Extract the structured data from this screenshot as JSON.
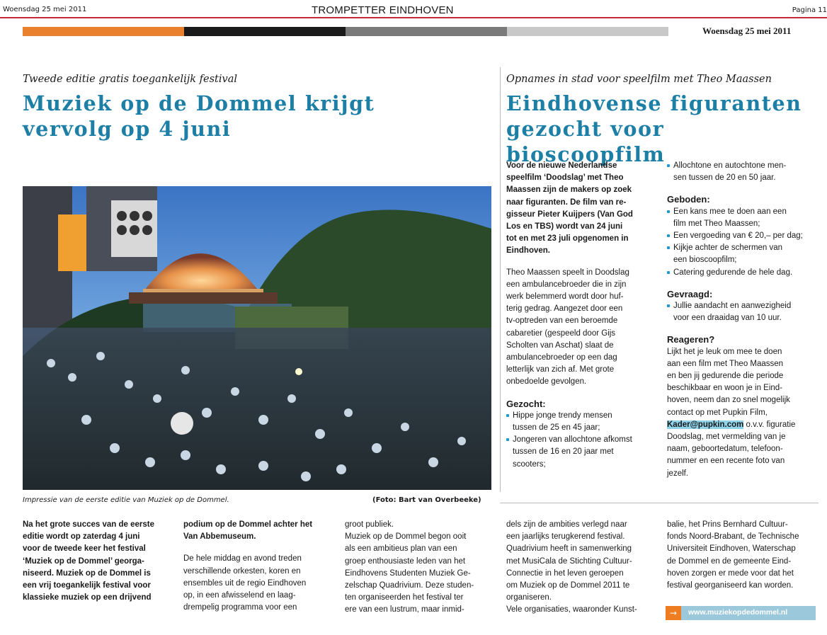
{
  "header": {
    "date_left": "Woensdag 25 mei 2011",
    "title": "TROMPETTER EINDHOVEN",
    "page": "Pagina 11",
    "date_right": "Woensdag 25 mei 2011",
    "colors": {
      "red_line": "#c8293a",
      "orange": "#e8802d",
      "dark": "#1a1a1a",
      "grey": "#7a7a7a",
      "light": "#c8c8c8"
    }
  },
  "left_article": {
    "kicker": "Tweede editie gratis toegankelijk festival",
    "headline_line1": "Muziek op de Dommel krijgt",
    "headline_line2": "vervolg op 4 juni",
    "caption": "Impressie van de eerste editie van Muziek op de Dommel.",
    "credit": "(Foto: Bart van Overbeeke)",
    "col1": [
      "Na het grote succes van de eerste",
      "editie wordt op zaterdag 4 juni",
      "voor de tweede keer het festival",
      "‘Muziek op de Dommel’ georga-",
      "niseerd. Muziek op de Dommel is",
      "een vrij toegankelijk festival voor",
      "klassieke muziek op een drijvend"
    ],
    "col2_bold": [
      "podium op de Dommel achter het",
      "Van Abbemuseum."
    ],
    "col2": [
      "De hele middag en avond treden",
      "verschillende orkesten, koren en",
      "ensembles uit de regio Eindhoven",
      "op, in een afwisselend en laag-",
      "drempelig programma voor een"
    ],
    "col3": [
      "groot publiek.",
      "Muziek op de Dommel begon ooit",
      "als een ambitieus plan van een",
      "groep enthousiaste leden van het",
      "Eindhovens Studenten Muziek Ge-",
      "zelschap Quadrivium. Deze studen-",
      "ten organiseerden het festival ter",
      "ere van een lustrum, maar inmid-"
    ],
    "col4": [
      "dels zijn de ambities verlegd naar",
      "een jaarlijks terugkerend festival.",
      "Quadrivium heeft in samenwerking",
      "met MusiCala de Stichting Cultuur-",
      "Connectie in het leven geroepen",
      "om Muziek op de Dommel 2011 te",
      "organiseren.",
      "Vele organisaties, waaronder Kunst-"
    ],
    "col5": [
      "balie, het Prins Bernhard Cultuur-",
      "fonds Noord-Brabant, de Technische",
      "Universiteit Eindhoven, Waterschap",
      "de Dommel en de gemeente Eind-",
      "hoven zorgen er mede voor dat het",
      "festival georganiseerd kan worden."
    ],
    "url": "www.muziekopdedommel.nl",
    "url_arrow": "→"
  },
  "right_article": {
    "kicker": "Opnames in stad voor speelfilm met Theo Maassen",
    "headline_line1": "Eindhovense figuranten",
    "headline_line2": "gezocht voor bioscoopfilm",
    "intro": [
      "Voor de nieuwe Nederlandse",
      "speelfilm ‘Doodslag’ met Theo",
      "Maassen zijn de makers op zoek",
      "naar figuranten. De film van re-",
      "gisseur Pieter Kuijpers (Van God",
      "Los en TBS) wordt van 24 juni",
      "tot en met 23 juli opgenomen in",
      "Eindhoven."
    ],
    "body": [
      "Theo Maassen speelt in Doodslag",
      "een ambulancebroeder die in zijn",
      "werk belemmerd wordt door huf-",
      "terig gedrag. Aangezet door een",
      "tv-optreden van een beroemde",
      "cabaretier (gespeeld door Gijs",
      "Scholten van Aschat) slaat de",
      "ambulancebroeder op een dag",
      "letterlijk van zich af. Met grote",
      "onbedoelde gevolgen."
    ],
    "gezocht_title": "Gezocht:",
    "gezocht": [
      [
        "Hippe jonge trendy mensen",
        "tussen de 25 en 45 jaar;"
      ],
      [
        "Jongeren van allochtone afkomst",
        "tussen de 16 en 20 jaar met",
        "scooters;"
      ]
    ],
    "col2_first": [
      "Allochtone en autochtone men-",
      "sen tussen de 20 en 50 jaar."
    ],
    "geboden_title": "Geboden:",
    "geboden": [
      [
        "Een kans  mee te doen aan een",
        "film met Theo Maassen;"
      ],
      [
        "Een vergoeding van € 20,– per dag;"
      ],
      [
        "Kijkje achter de schermen van",
        "een bioscoopfilm;"
      ],
      [
        "Catering gedurende de hele dag."
      ]
    ],
    "gevraagd_title": "Gevraagd:",
    "gevraagd": [
      [
        "Jullie aandacht en aanwezigheid",
        "voor een draaidag van 10 uur."
      ]
    ],
    "reageren_title": "Reageren?",
    "reageren": [
      "Lijkt het je leuk om mee te doen",
      "aan een film met Theo Maassen",
      "en ben jij gedurende die periode",
      "beschikbaar en woon je in Eind-",
      "hoven, neem dan zo snel mogelijk",
      "contact op met Pupkin Film,"
    ],
    "email": "Kader@pupkin.com",
    "reageren_after_email": " o.v.v. figuratie",
    "reageren2": [
      "Doodslag, met vermelding van je",
      "naam, geboortedatum, telefoon-",
      "nummer en een recente foto van",
      "jezelf."
    ]
  }
}
